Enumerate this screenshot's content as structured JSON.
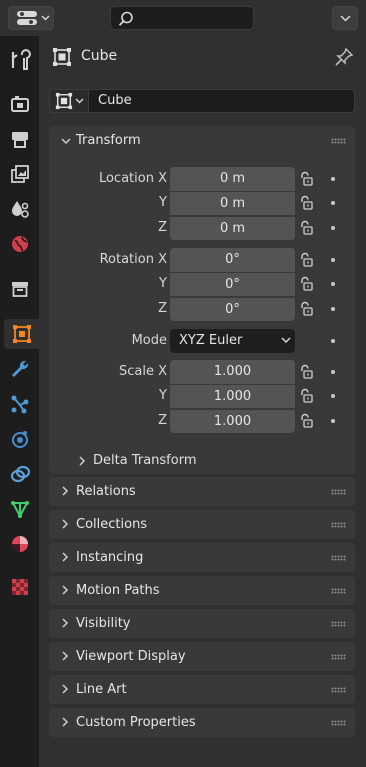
{
  "context": {
    "object_name": "Cube"
  },
  "name_field": {
    "value": "Cube"
  },
  "transform": {
    "title": "Transform",
    "location": {
      "label_x": "Location X",
      "label_y": "Y",
      "label_z": "Z",
      "x": "0 m",
      "y": "0 m",
      "z": "0 m"
    },
    "rotation": {
      "label_x": "Rotation X",
      "label_y": "Y",
      "label_z": "Z",
      "x": "0°",
      "y": "0°",
      "z": "0°"
    },
    "mode": {
      "label": "Mode",
      "value": "XYZ Euler"
    },
    "scale": {
      "label_x": "Scale X",
      "label_y": "Y",
      "label_z": "Z",
      "x": "1.000",
      "y": "1.000",
      "z": "1.000"
    },
    "delta": "Delta Transform"
  },
  "panels": [
    "Relations",
    "Collections",
    "Instancing",
    "Motion Paths",
    "Visibility",
    "Viewport Display",
    "Line Art",
    "Custom Properties"
  ],
  "colors": {
    "object_orange": "#f5861f",
    "modifier_blue": "#4e9ad6",
    "physics_blue": "#4a8ccf",
    "constraint_blue": "#5ba0da",
    "data_green": "#44cc6e",
    "material_red": "#e0465a",
    "texture_red": "#d1404a"
  },
  "tabs": [
    "tool-icon",
    "render-icon",
    "output-icon",
    "view-layer-icon",
    "scene-icon",
    "world-icon",
    "collection-icon",
    "object-icon",
    "modifier-icon",
    "particles-icon",
    "physics-icon",
    "constraints-icon",
    "data-icon",
    "material-icon",
    "texture-icon"
  ]
}
